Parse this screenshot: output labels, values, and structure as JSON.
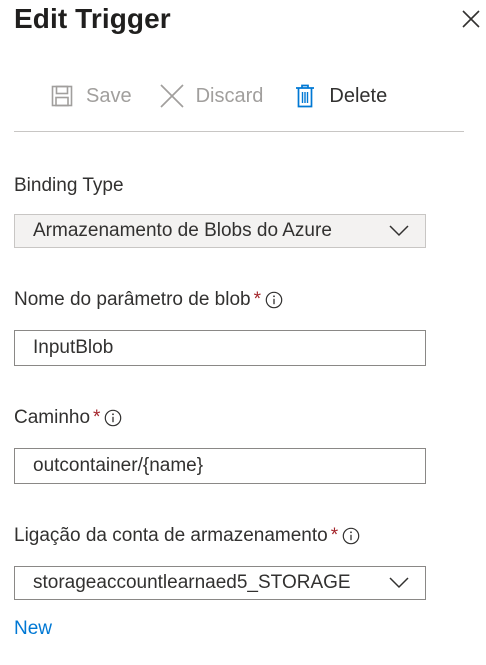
{
  "panel": {
    "title": "Edit Trigger"
  },
  "toolbar": {
    "save_label": "Save",
    "discard_label": "Discard",
    "delete_label": "Delete"
  },
  "fields": {
    "binding_type": {
      "label": "Binding Type",
      "value": "Armazenamento de Blobs do Azure"
    },
    "blob_param": {
      "label": "Nome do parâmetro de blob",
      "required_mark": "*",
      "value": "InputBlob"
    },
    "path": {
      "label": "Caminho",
      "required_mark": "*",
      "value": "outcontainer/{name}"
    },
    "storage_connection": {
      "label": "Ligação da conta de armazenamento",
      "required_mark": "*",
      "value": "storageaccountlearnaed5_STORAGE"
    }
  },
  "new_link": "New",
  "icons": {
    "close": "close-icon",
    "save": "save-icon",
    "discard": "discard-icon",
    "delete": "delete-icon",
    "info": "info-icon",
    "chevron": "chevron-down-icon"
  },
  "colors": {
    "accent": "#0078d4",
    "required": "#a4262c",
    "disabled": "#a19f9d"
  }
}
